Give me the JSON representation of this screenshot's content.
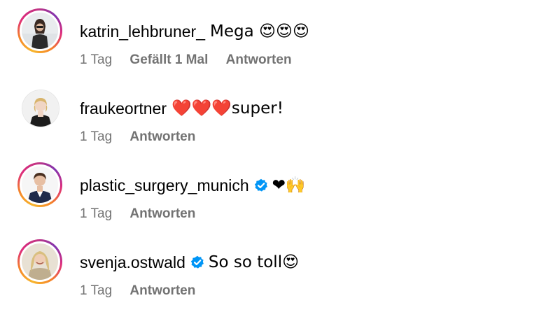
{
  "comments": [
    {
      "username": "katrin_lehbruner_",
      "verified": false,
      "text": "Mega 😍😍😍",
      "time": "1 Tag",
      "likes_label": "Gefällt 1 Mal",
      "reply_label": "Antworten",
      "story_ring": true
    },
    {
      "username": "fraukeortner",
      "verified": false,
      "text": "❤️❤️❤️super!",
      "time": "1 Tag",
      "reply_label": "Antworten",
      "story_ring": false
    },
    {
      "username": "plastic_surgery_munich",
      "verified": true,
      "text": "❤🙌",
      "time": "1 Tag",
      "reply_label": "Antworten",
      "story_ring": true
    },
    {
      "username": "svenja.ostwald",
      "verified": true,
      "text": "So so toll😍",
      "time": "1 Tag",
      "reply_label": "Antworten",
      "story_ring": true
    }
  ],
  "colors": {
    "meta_text": "#737373",
    "verified_blue": "#0095f6"
  }
}
